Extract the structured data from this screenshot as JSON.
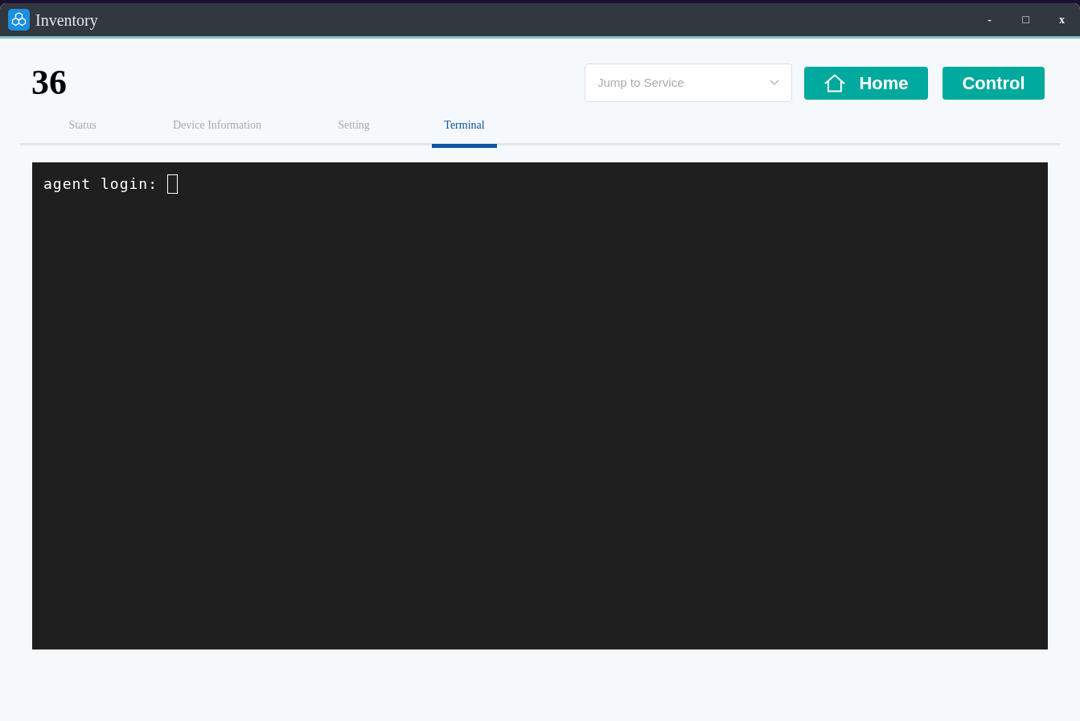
{
  "window": {
    "title": "Inventory",
    "controls": [
      "-",
      "□",
      "x"
    ]
  },
  "header": {
    "number": "36",
    "service_select": {
      "placeholder": "Jump to Service"
    },
    "buttons": [
      {
        "kind": "home",
        "label": "Home"
      },
      {
        "kind": "plain",
        "label": "Control"
      }
    ]
  },
  "tabs": [
    {
      "label": "Status",
      "selected": false
    },
    {
      "label": "Device Information",
      "selected": false
    },
    {
      "label": "Setting",
      "selected": false
    },
    {
      "label": "Terminal",
      "selected": true
    }
  ],
  "terminal": {
    "prompt": "agent login:"
  }
}
